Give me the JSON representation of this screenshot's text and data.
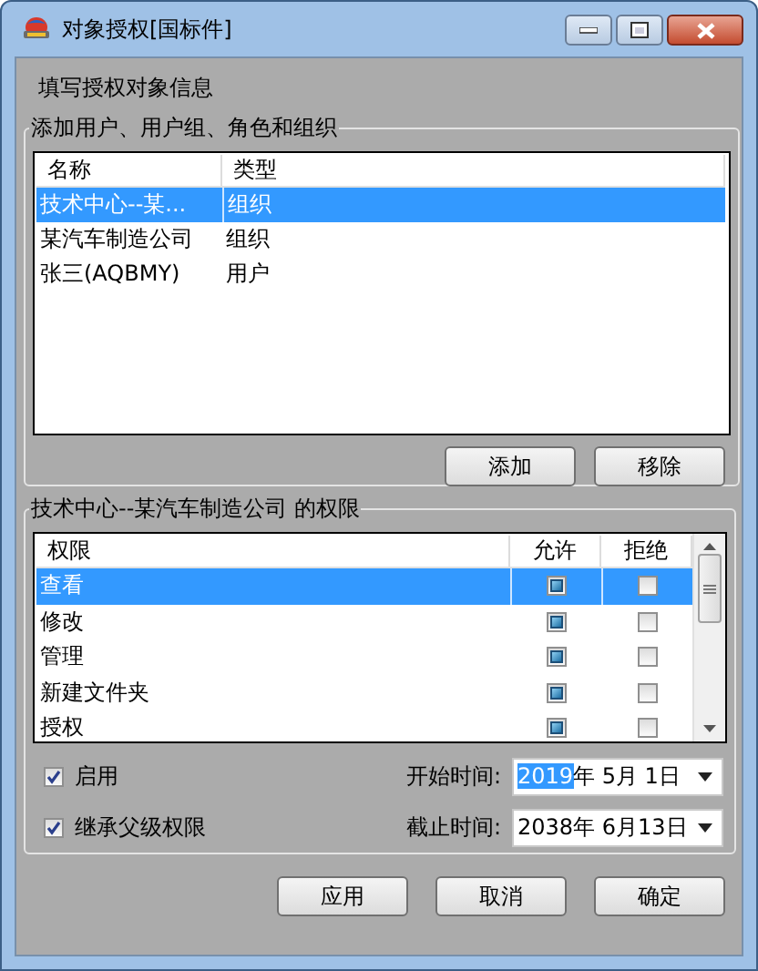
{
  "window": {
    "title": "对象授权[国标件]",
    "controls": [
      {
        "kind": "minimize"
      },
      {
        "kind": "maximize"
      },
      {
        "kind": "close"
      }
    ]
  },
  "heading": "填写授权对象信息",
  "principals": {
    "group_title": "添加用户、用户组、角色和组织",
    "columns": [
      "名称",
      "类型"
    ],
    "rows": [
      {
        "name": "技术中心--某...",
        "type": "组织",
        "selected": true
      },
      {
        "name": "某汽车制造公司",
        "type": "组织",
        "selected": false
      },
      {
        "name": "张三(AQBMY)",
        "type": "用户",
        "selected": false
      }
    ],
    "buttons": [
      "添加",
      "移除"
    ]
  },
  "permissions": {
    "group_title": "技术中心--某汽车制造公司 的权限",
    "columns": [
      "权限",
      "允许",
      "拒绝"
    ],
    "rows": [
      {
        "name": "查看",
        "allow": true,
        "deny": false,
        "selected": true
      },
      {
        "name": "修改",
        "allow": true,
        "deny": false,
        "selected": false
      },
      {
        "name": "管理",
        "allow": true,
        "deny": false,
        "selected": false
      },
      {
        "name": "新建文件夹",
        "allow": true,
        "deny": false,
        "selected": false
      },
      {
        "name": "授权",
        "allow": true,
        "deny": false,
        "selected": false
      }
    ]
  },
  "options": [
    {
      "label": "启用",
      "checked": true
    },
    {
      "label": "继承父级权限",
      "checked": true
    }
  ],
  "dates": [
    {
      "label": "开始时间:",
      "year": "2019",
      "rest": "年 5月 1日",
      "year_selected": true
    },
    {
      "label": "截止时间:",
      "year": "2038",
      "rest": "年 6月13日",
      "year_selected": false
    }
  ],
  "buttons": [
    "应用",
    "取消",
    "确定"
  ]
}
